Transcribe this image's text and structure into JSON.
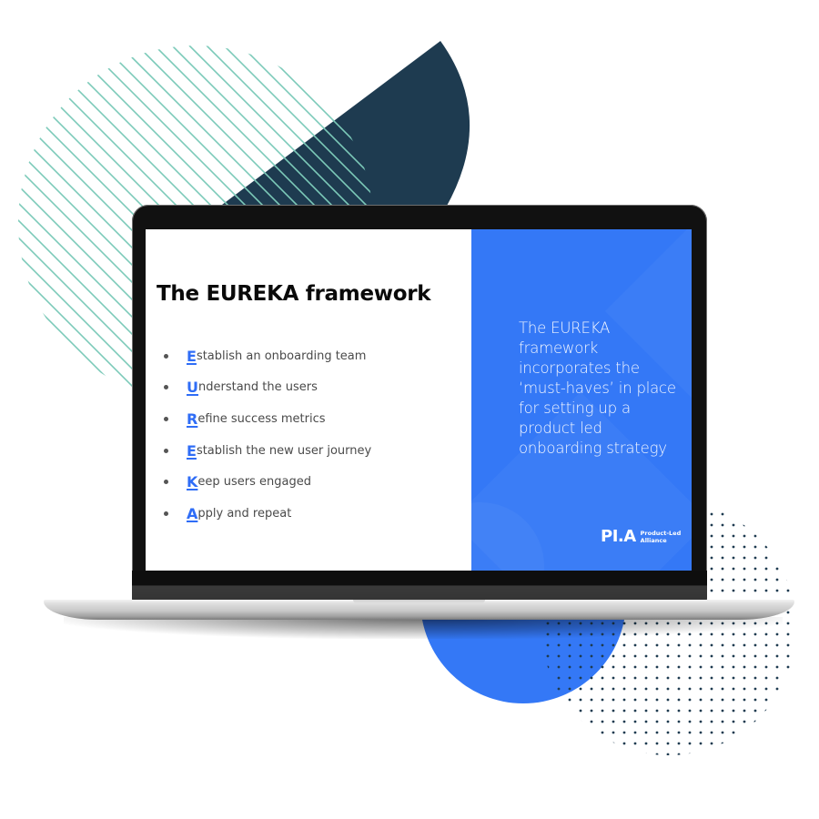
{
  "colors": {
    "stripe": "#7ccab9",
    "navy_shape": "#1e3b50",
    "blue_circle": "#3478f6",
    "dots": "#1e3b50",
    "slide_accent": "#2f6df6",
    "slide_panel": "#3478f6"
  },
  "slide": {
    "title": "The EUREKA framework",
    "bullets": [
      {
        "letter": "E",
        "rest": "stablish an onboarding team"
      },
      {
        "letter": "U",
        "rest": "nderstand the users"
      },
      {
        "letter": "R",
        "rest": "efine success metrics"
      },
      {
        "letter": "E",
        "rest": "stablish the new user journey"
      },
      {
        "letter": "K",
        "rest": "eep users engaged"
      },
      {
        "letter": "A",
        "rest": "pply and repeat"
      }
    ],
    "panel_text": "The EUREKA framework incorporates the ‘must-haves’ in place for setting up a product led onboarding strategy",
    "logo": {
      "mark": "PI.A",
      "name_line1": "Product-Led",
      "name_line2": "Alliance"
    }
  },
  "decor": {
    "stripe_icon": "diagonal-stripes-circle",
    "navy_icon": "navy-leaf-shape",
    "circle_icon": "blue-circle",
    "dots_icon": "dot-grid-circle"
  }
}
